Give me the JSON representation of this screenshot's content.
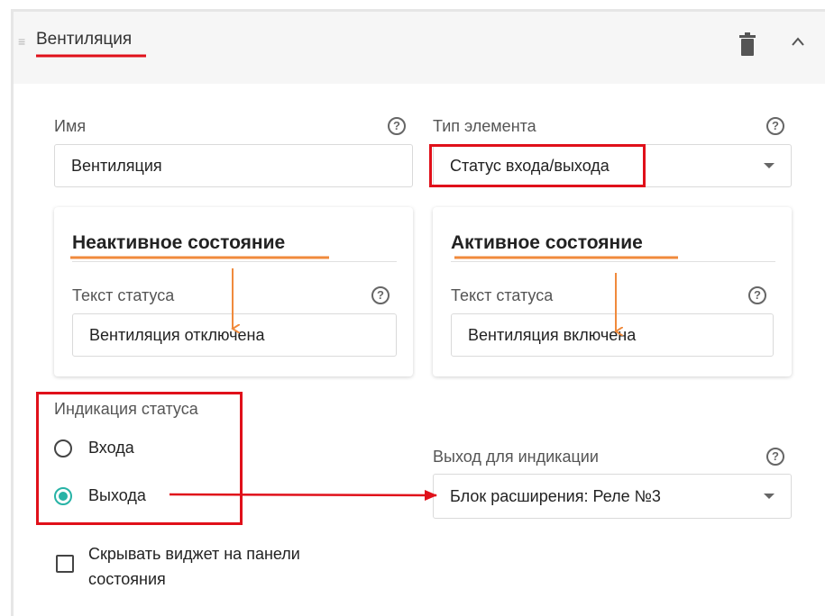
{
  "header": {
    "title": "Вентиляция",
    "drag_glyph": "≡",
    "collapse_glyph": "^"
  },
  "name_field": {
    "label": "Имя",
    "value": "Вентиляция",
    "help": "?"
  },
  "type_field": {
    "label": "Тип элемента",
    "value": "Статус входа/выхода",
    "help": "?"
  },
  "inactive_card": {
    "title": "Неактивное состояние",
    "field_label": "Текст статуса",
    "value": "Вентиляция отключена",
    "help": "?"
  },
  "active_card": {
    "title": "Активное состояние",
    "field_label": "Текст статуса",
    "value": "Вентиляция включена",
    "help": "?"
  },
  "status_indication": {
    "label": "Индикация статуса",
    "options": [
      {
        "label": "Входа",
        "selected": false
      },
      {
        "label": "Выхода",
        "selected": true
      }
    ]
  },
  "output_field": {
    "label": "Выход для индикации",
    "value": "Блок расширения: Реле №3",
    "help": "?"
  },
  "hide_widget": {
    "label_line1": "Скрывать виджет на панели",
    "label_line2": "состояния",
    "checked": false
  },
  "colors": {
    "accent": "#27b3a6",
    "annotation_red": "#e0101a",
    "annotation_orange": "#f08a3c"
  },
  "icons": [
    "drag-handle-icon",
    "trash-icon",
    "chevron-up-icon",
    "help-icon",
    "dropdown-caret-icon"
  ]
}
